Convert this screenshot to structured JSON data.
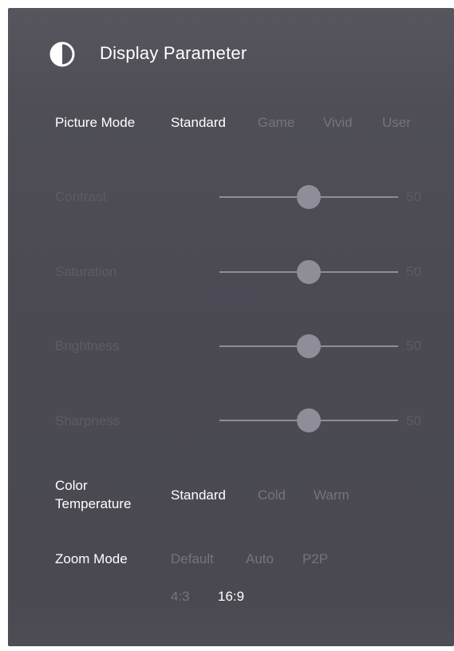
{
  "header": {
    "title": "Display Parameter",
    "icon": "contrast-icon"
  },
  "picture_mode": {
    "label": "Picture Mode",
    "options": [
      "Standard",
      "Game",
      "Vivid",
      "User"
    ],
    "selected": "Standard"
  },
  "sliders": [
    {
      "label": "Contrast",
      "value": "50"
    },
    {
      "label": "Saturation",
      "value": "50"
    },
    {
      "label": "Brightness",
      "value": "50"
    },
    {
      "label": "Sharpness",
      "value": "50"
    }
  ],
  "color_temperature": {
    "label_line1": "Color",
    "label_line2": "Temperature",
    "options": [
      "Standard",
      "Cold",
      "Warm"
    ],
    "selected": "Standard"
  },
  "zoom_mode": {
    "label": "Zoom Mode",
    "options": [
      "Default",
      "Auto",
      "P2P",
      "4:3",
      "16:9"
    ],
    "selected": "16:9"
  },
  "colors": {
    "selected_text": "#ffffff",
    "unselected_text": "#75747e",
    "disabled_text": "#5d5c66",
    "panel_bg": "#4b4a53"
  }
}
